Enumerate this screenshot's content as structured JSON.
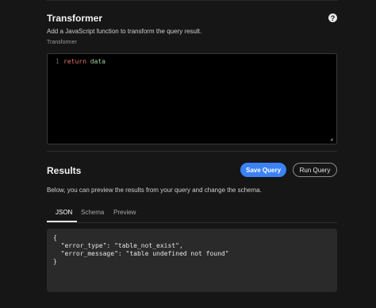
{
  "transformer": {
    "title": "Transformer",
    "description": "Add a JavaScript function to transform the query result.",
    "field_label": "Transformer",
    "editor": {
      "line_number": "1",
      "keyword": "return",
      "identifier": "data"
    }
  },
  "results": {
    "title": "Results",
    "save_label": "Save Query",
    "run_label": "Run Query",
    "description": "Below, you can preview the results from your query and change the schema.",
    "tabs": [
      {
        "label": "JSON",
        "active": true
      },
      {
        "label": "Schema",
        "active": false
      },
      {
        "label": "Preview",
        "active": false
      }
    ],
    "json_lines": [
      "{",
      "  \"error_type\": \"table_not_exist\",",
      "  \"error_message\": \"table undefined not found\"",
      "}"
    ]
  },
  "colors": {
    "accent": "#3b82f6",
    "background": "#161616",
    "editor_bg": "#000000",
    "json_bg": "#2a2a2a"
  },
  "icons": {
    "help": "question-circle-icon",
    "resize": "resize-handle-icon"
  }
}
